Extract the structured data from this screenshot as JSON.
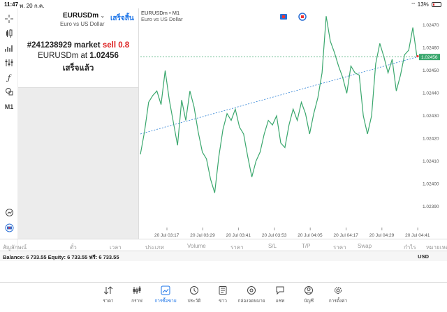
{
  "status": {
    "time": "11:47",
    "date": "พ. 20 ก.ค.",
    "battery": "13%"
  },
  "header": {
    "symbol": "EURUSDm",
    "description": "Euro vs US Dollar",
    "done_label": "เสร็จสิ้น"
  },
  "message": {
    "order_prefix": "#241238929 market",
    "side": "sell 0.8",
    "line2_prefix": "EURUSDm at",
    "price": "1.02456",
    "status": "เสร็จแล้ว"
  },
  "chart": {
    "title": "EURUSDm • M1",
    "subtitle": "Euro vs US Dollar",
    "timeframe": "M1",
    "current_price_label": "1.02456",
    "colors": {
      "line": "#3aa76d",
      "trend": "#2a7fd4",
      "price_line": "#3aa76d"
    }
  },
  "chart_data": {
    "type": "line",
    "y_ticks": [
      "1.02470",
      "1.02460",
      "1.02450",
      "1.02440",
      "1.02430",
      "1.02420",
      "1.02410",
      "1.02400",
      "1.02390"
    ],
    "x_ticks": [
      "20 Jul 03:17",
      "20 Jul 03:29",
      "20 Jul 03:41",
      "20 Jul 03:53",
      "20 Jul 04:05",
      "20 Jul 04:17",
      "20 Jul 04:29",
      "20 Jul 04:41"
    ],
    "ylim": [
      1.02385,
      1.02475
    ],
    "current_price": 1.02456,
    "trend": [
      [
        0,
        1.02422
      ],
      [
        1,
        1.02456
      ]
    ],
    "series": [
      1.02413,
      1.02423,
      1.02436,
      1.02439,
      1.02441,
      1.02435,
      1.0245,
      1.02437,
      1.02427,
      1.02417,
      1.02437,
      1.02428,
      1.02441,
      1.02434,
      1.02423,
      1.02414,
      1.02411,
      1.02402,
      1.02396,
      1.02412,
      1.02424,
      1.02431,
      1.02428,
      1.02433,
      1.02425,
      1.02422,
      1.02412,
      1.02403,
      1.0241,
      1.02414,
      1.02422,
      1.02428,
      1.02426,
      1.0243,
      1.02418,
      1.02416,
      1.02426,
      1.02433,
      1.02428,
      1.02436,
      1.02431,
      1.02422,
      1.02431,
      1.02438,
      1.02449,
      1.02474,
      1.02463,
      1.02458,
      1.02452,
      1.02447,
      1.0244,
      1.02452,
      1.02449,
      1.02448,
      1.0243,
      1.02422,
      1.0243,
      1.02453,
      1.02462,
      1.02456,
      1.02449,
      1.02455,
      1.02441,
      1.02448,
      1.02457,
      1.02459,
      1.02469,
      1.02456
    ]
  },
  "left_tools": [
    "crosshair-icon",
    "indicators-icon",
    "objects-icon",
    "bars-icon",
    "function-icon",
    "shapes-icon"
  ],
  "columns": [
    "สัญลักษณ์",
    "ตั๋ว",
    "เวลา",
    "ประเภท",
    "Volume",
    "ราคา",
    "S/L",
    "T/P",
    "ราคา",
    "Swap",
    "กำไร",
    "หมายเหตุ"
  ],
  "balance": {
    "text": "Balance: 6 733.55 Equity: 6 733.55 ฟรี: 6 733.55",
    "currency": "USD"
  },
  "tabs": [
    {
      "label": "ราคา",
      "icon": "quotes-icon"
    },
    {
      "label": "กราฟ",
      "icon": "chart-icon"
    },
    {
      "label": "การซื้อขาย",
      "icon": "trade-icon",
      "active": true
    },
    {
      "label": "ประวัติ",
      "icon": "history-icon"
    },
    {
      "label": "ข่าว",
      "icon": "news-icon"
    },
    {
      "label": "กล่องจดหมาย",
      "icon": "mailbox-icon"
    },
    {
      "label": "แชท",
      "icon": "chat-icon"
    },
    {
      "label": "บัญชี",
      "icon": "account-icon"
    },
    {
      "label": "การตั้งค่า",
      "icon": "settings-icon"
    }
  ]
}
